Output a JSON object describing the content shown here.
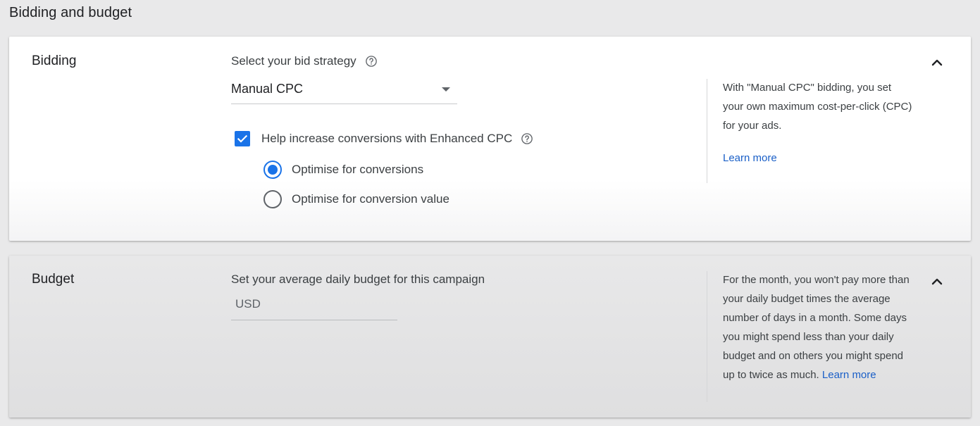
{
  "page": {
    "title": "Bidding and budget"
  },
  "bidding": {
    "label": "Bidding",
    "strategy_label": "Select your bid strategy",
    "strategy_value": "Manual CPC",
    "enhanced_cpc_label": "Help increase conversions with Enhanced CPC",
    "enhanced_cpc_checked": true,
    "options": [
      {
        "label": "Optimise for conversions",
        "checked": true
      },
      {
        "label": "Optimise for conversion value",
        "checked": false
      }
    ],
    "info_text": "With \"Manual CPC\" bidding, you set your own maximum cost-per-click (CPC) for your ads.",
    "learn_more": "Learn more"
  },
  "budget": {
    "label": "Budget",
    "field_label": "Set your average daily budget for this campaign",
    "currency": "USD",
    "info_text": "For the month, you won't pay more than your daily budget times the average number of days in a month. Some days you might spend less than your daily budget and on others you might spend up to twice as much.",
    "learn_more": "Learn more"
  },
  "colors": {
    "accent": "#1a73e8",
    "link": "#1a5fc7"
  },
  "icons": {
    "help": "help-circle-icon",
    "collapse": "chevron-up-icon",
    "check": "check-icon",
    "dropdown": "caret-down-icon"
  }
}
